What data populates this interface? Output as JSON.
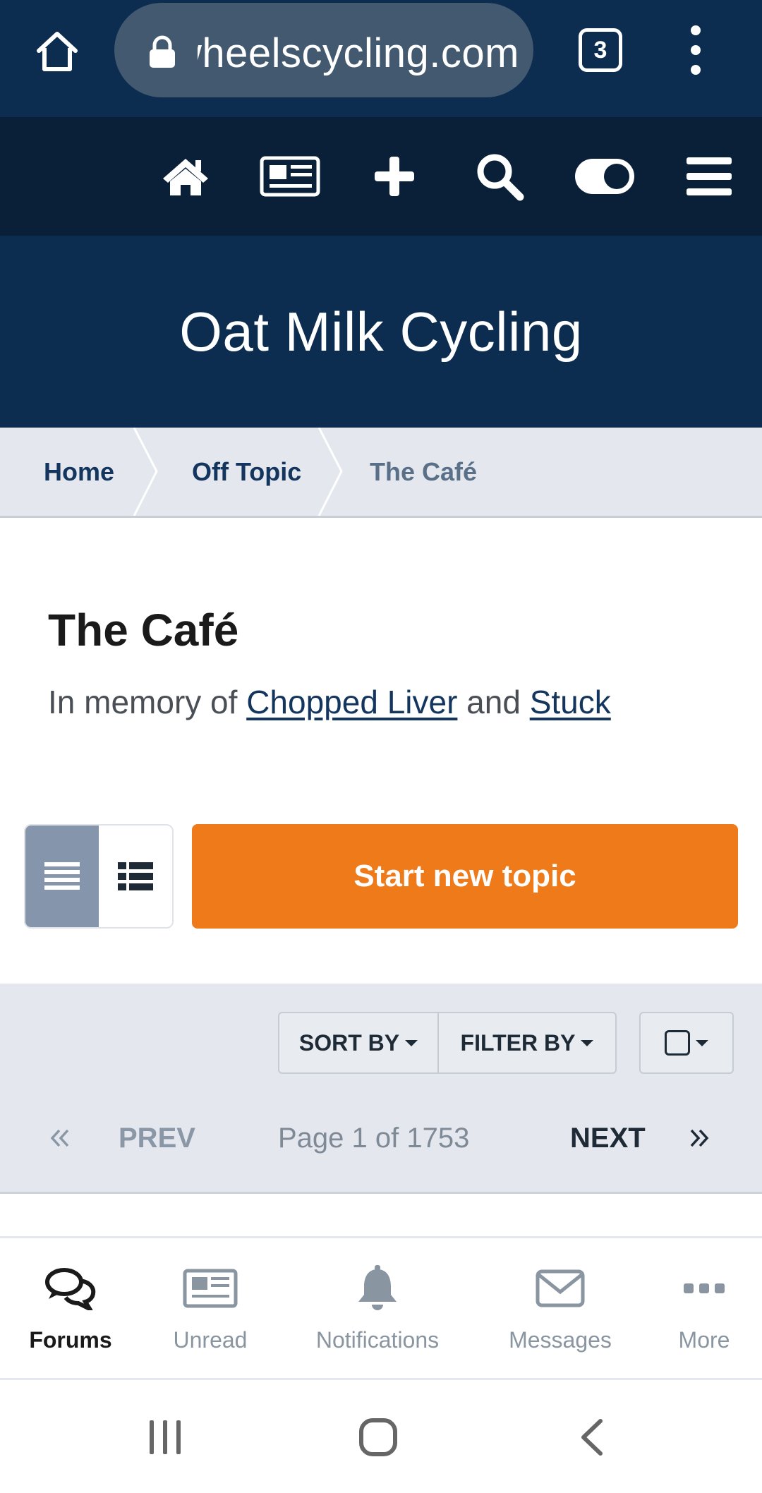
{
  "browser": {
    "url": "wheelscycling.com",
    "tab_count": "3",
    "icons": [
      "home-icon",
      "lock-icon",
      "tabs-icon",
      "menu-dots-icon"
    ]
  },
  "site_nav": {
    "icons": [
      "home-icon",
      "newspaper-icon",
      "plus-icon",
      "search-icon",
      "toggle-icon",
      "hamburger-icon"
    ]
  },
  "site": {
    "title": "Oat Milk Cycling"
  },
  "breadcrumb": {
    "items": [
      {
        "label": "Home"
      },
      {
        "label": "Off Topic"
      },
      {
        "label": "The Café"
      }
    ]
  },
  "page": {
    "title": "The Café",
    "desc_prefix": "In memory of ",
    "desc_link1": "Chopped Liver",
    "desc_mid": " and ",
    "desc_link2": "Stuck"
  },
  "actions": {
    "start_topic": "Start new topic"
  },
  "controls": {
    "sort_by": "SORT BY",
    "filter_by": "FILTER BY",
    "prev": "PREV",
    "page_info": "Page 1 of 1753",
    "next": "NEXT"
  },
  "app_nav": {
    "tabs": [
      {
        "label": "Forums",
        "icon": "chat-bubbles-icon"
      },
      {
        "label": "Unread",
        "icon": "newspaper-icon"
      },
      {
        "label": "Notifications",
        "icon": "bell-icon"
      },
      {
        "label": "Messages",
        "icon": "envelope-icon"
      },
      {
        "label": "More",
        "icon": "ellipsis-icon"
      }
    ]
  },
  "colors": {
    "brand_navy": "#0c2d4f",
    "accent_orange": "#ee7a1a",
    "panel_gray": "#e4e8ee"
  }
}
